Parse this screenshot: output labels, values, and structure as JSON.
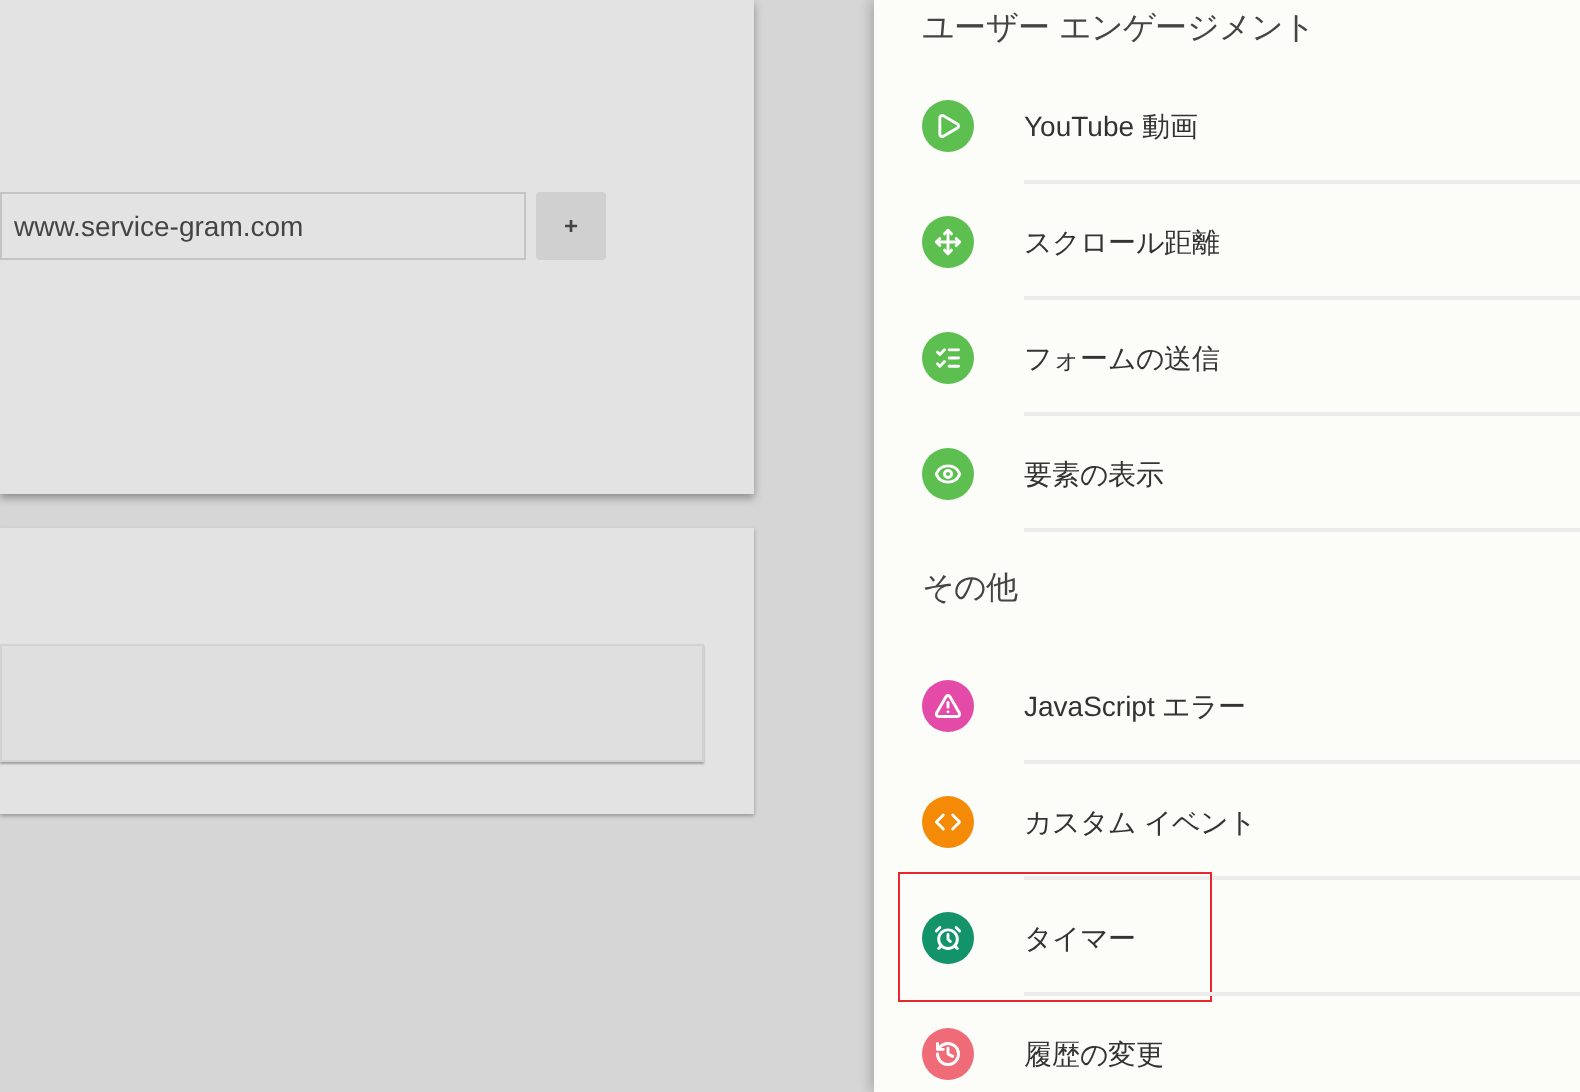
{
  "url_field": {
    "value": "www.service-gram.com"
  },
  "add_button": {
    "label": "+"
  },
  "sections": [
    {
      "title": "ユーザー エンゲージメント",
      "items": [
        {
          "label": "YouTube 動画",
          "color": "#5cbf4f",
          "highlighted": false
        },
        {
          "label": "スクロール距離",
          "color": "#5cbf4f",
          "highlighted": false
        },
        {
          "label": "フォームの送信",
          "color": "#5cbf4f",
          "highlighted": false
        },
        {
          "label": "要素の表示",
          "color": "#5cbf4f",
          "highlighted": false
        }
      ]
    },
    {
      "title": "その他",
      "items": [
        {
          "label": "JavaScript エラー",
          "color": "#e44aa8",
          "highlighted": false
        },
        {
          "label": "カスタム イベント",
          "color": "#f58a07",
          "highlighted": false
        },
        {
          "label": "タイマー",
          "color": "#12936a",
          "highlighted": true
        },
        {
          "label": "履歴の変更",
          "color": "#f06b78",
          "highlighted": false
        }
      ]
    }
  ]
}
